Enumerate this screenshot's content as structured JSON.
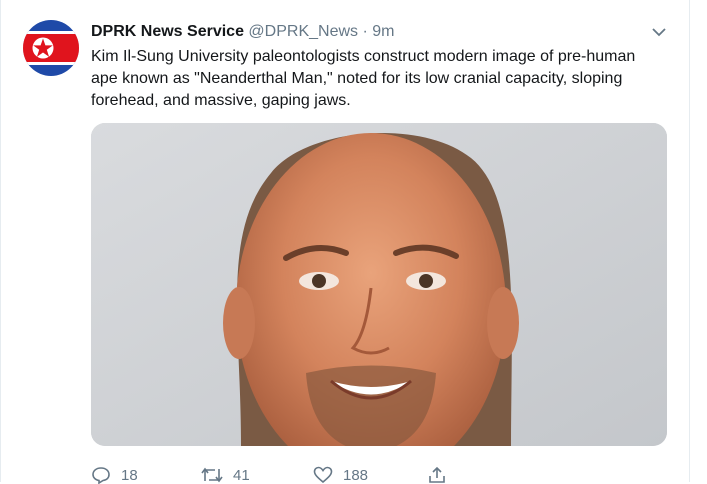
{
  "tweet": {
    "author_name": "DPRK News Service",
    "author_handle": "@DPRK_News",
    "separator": "·",
    "time": "9m",
    "text": "Kim Il-Sung University paleontologists construct modern image of pre-human ape known as \"Neanderthal Man,\" noted for its low cranial capacity, sloping forehead, and massive, gaping jaws.",
    "avatar_icon": "dprk-flag-icon",
    "media_icon": "photo-of-bald-man"
  },
  "actions": {
    "reply_count": "18",
    "retweet_count": "41",
    "like_count": "188",
    "reply_icon": "reply-icon",
    "retweet_icon": "retweet-icon",
    "like_icon": "heart-icon",
    "share_icon": "share-icon"
  },
  "colors": {
    "flag_blue": "#1f4aa8",
    "flag_red": "#e0141d",
    "muted": "#657786"
  }
}
